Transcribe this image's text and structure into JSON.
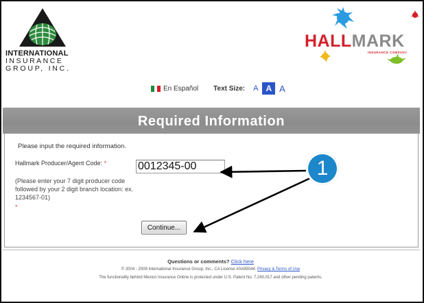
{
  "header": {
    "iig_logo": {
      "line1": "INTERNATIONAL",
      "line2": "INSURANCE",
      "line3": "GROUP, INC."
    },
    "hallmark_logo": {
      "word_red": "HALL",
      "word_grey": "MARK",
      "subtitle": "INSURANCE COMPANY"
    }
  },
  "language_bar": {
    "spanish_link": "En Español",
    "text_size_label": "Text Size:",
    "size_small": "A",
    "size_medium": "A",
    "size_large": "A"
  },
  "section": {
    "title": "Required Information",
    "intro": "Please input the required information.",
    "field_label": "Hallmark Producer/Agent Code:",
    "required_marker": "*",
    "hint": "(Please enter your 7 digit producer code followed by your 2 digit branch location: ex. 1234567-01)",
    "hint_star": "*",
    "agent_code_value": "0012345-00",
    "continue_label": "Continue..."
  },
  "annotation": {
    "step_number": "1"
  },
  "footer": {
    "questions_text": "Questions or comments?",
    "click_here": "Click here",
    "copyright_text": "© 2004 - 2009 International Insurance Group, Inc., CA License #0A99044.",
    "privacy_link": "Privacy & Terms of Use",
    "patent_text": "The functionality behind Mexico Insurance Online is protected under U.S. Patent No. 7,240,017 and other pending patents."
  },
  "colors": {
    "accent_blue": "#1d87cb",
    "hallmark_red": "#d4202a",
    "header_bar_grey": "#949494",
    "link_blue": "#2a55c8"
  }
}
